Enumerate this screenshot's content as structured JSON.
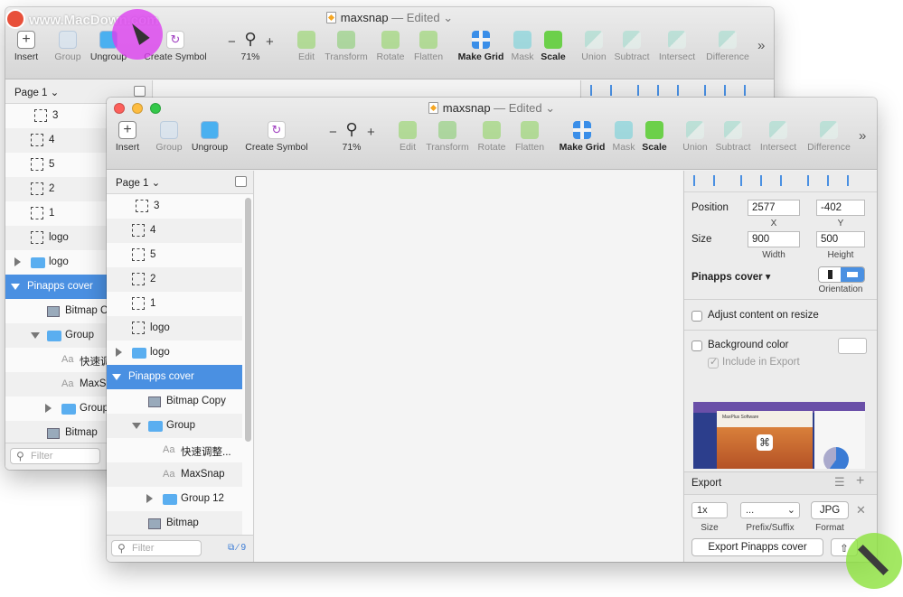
{
  "watermark": "www.MacDown.com",
  "window": {
    "title": "maxsnap",
    "title_suffix": "— Edited",
    "title_chevron": "⌄"
  },
  "toolbar": {
    "insert": "Insert",
    "group": "Group",
    "ungroup": "Ungroup",
    "create_symbol": "Create Symbol",
    "zoom_minus": "−",
    "zoom_plus": "+",
    "zoom_level": "71%",
    "edit": "Edit",
    "transform": "Transform",
    "rotate": "Rotate",
    "flatten": "Flatten",
    "make_grid": "Make Grid",
    "mask": "Mask",
    "scale": "Scale",
    "union": "Union",
    "subtract": "Subtract",
    "intersect": "Intersect",
    "difference": "Difference",
    "more": "»"
  },
  "sidebar": {
    "page": "Page 1 ⌄",
    "filter_placeholder": "Filter",
    "slice_count": "9",
    "layers": [
      {
        "label": "3"
      },
      {
        "label": "4"
      },
      {
        "label": "5"
      },
      {
        "label": "2"
      },
      {
        "label": "1"
      },
      {
        "label": "logo"
      },
      {
        "label": "logo"
      },
      {
        "label": "Pinapps cover"
      },
      {
        "label": "Bitmap Copy"
      },
      {
        "label": "Group"
      },
      {
        "label": "快速调整..."
      },
      {
        "label": "MaxSnap"
      },
      {
        "label": "Group 12"
      },
      {
        "label": "Bitmap"
      }
    ],
    "back_layers": [
      {
        "label": "3"
      },
      {
        "label": "4"
      },
      {
        "label": "5"
      },
      {
        "label": "2"
      },
      {
        "label": "1"
      },
      {
        "label": "logo"
      },
      {
        "label": "logo"
      },
      {
        "label": "Pinapps cover"
      },
      {
        "label": "Bitmap C"
      },
      {
        "label": "Group"
      },
      {
        "label": "快速调"
      },
      {
        "label": "MaxSr"
      },
      {
        "label": "Group"
      },
      {
        "label": "Bitmap"
      }
    ]
  },
  "inspector": {
    "position_label": "Position",
    "x_value": "2577",
    "y_value": "-402",
    "x_label": "X",
    "y_label": "Y",
    "size_label": "Size",
    "width_value": "900",
    "height_value": "500",
    "width_label": "Width",
    "height_label": "Height",
    "artboard_name": "Pinapps cover ▾",
    "orientation_label": "Orientation",
    "adjust_content": "Adjust content on resize",
    "background_color": "Background color",
    "include_export": "Include in Export",
    "preview_text": "MaxPlus Software",
    "export_title": "Export",
    "export_size": "1x",
    "export_prefix": "...",
    "export_format": "JPG",
    "size_caption": "Size",
    "prefix_caption": "Prefix/Suffix",
    "format_caption": "Format",
    "export_button": "Export Pinapps cover"
  }
}
